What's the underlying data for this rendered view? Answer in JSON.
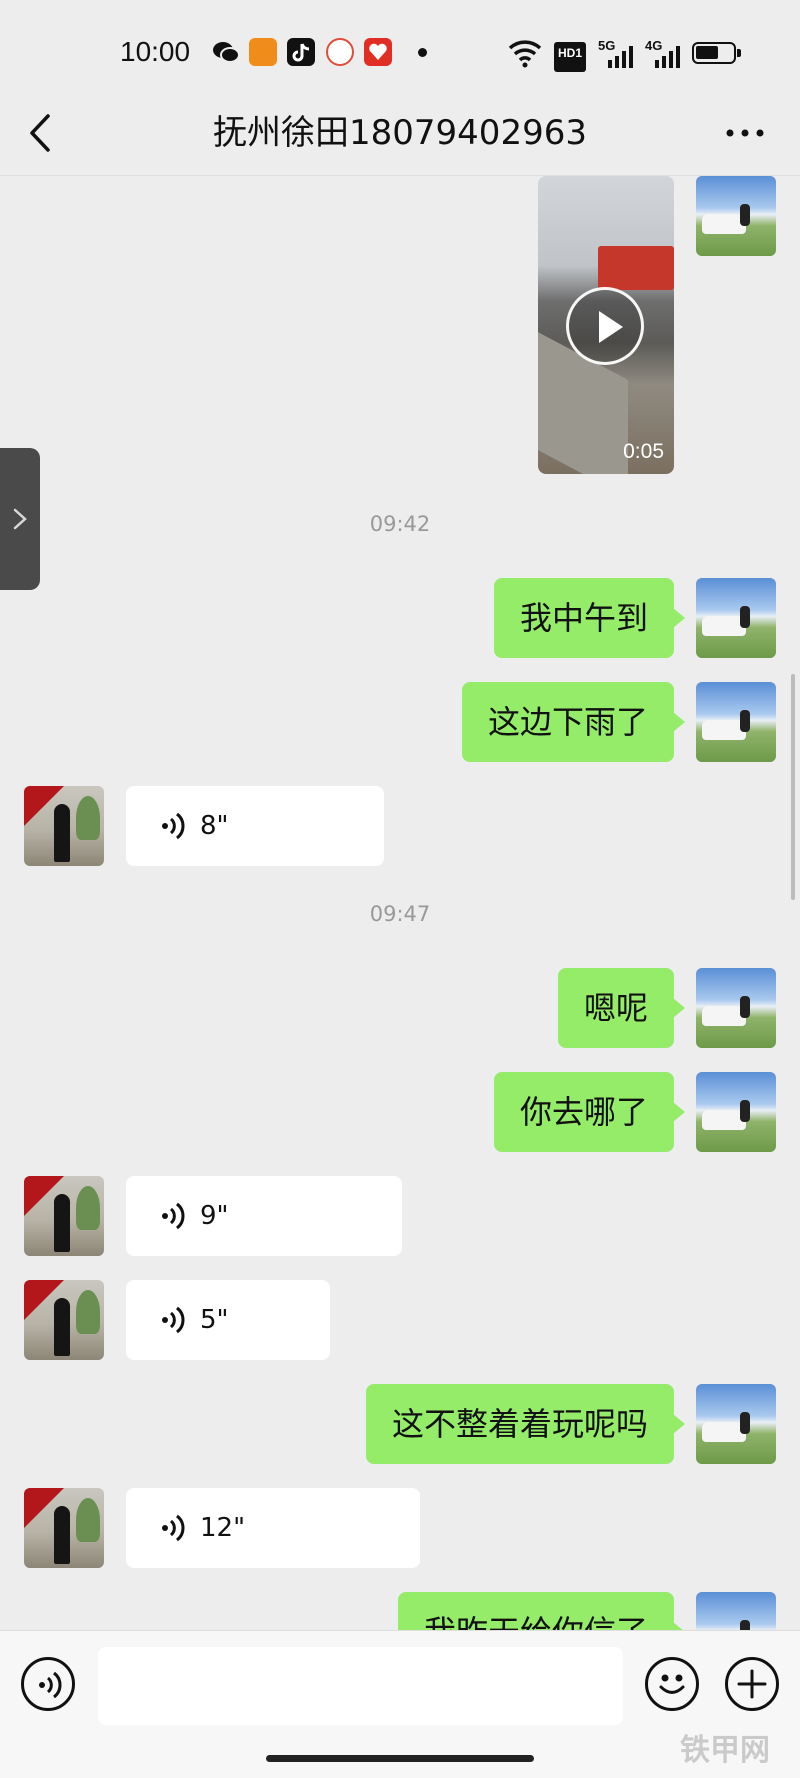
{
  "status_bar": {
    "time": "10:00",
    "apps": [
      {
        "icon": "wechat-icon",
        "color": "#111111"
      },
      {
        "icon": "bus-app-icon",
        "color": "#f08c1a"
      },
      {
        "icon": "tiktok-icon",
        "color": "#111111"
      },
      {
        "icon": "news-app-icon",
        "color": "#e34b3b"
      },
      {
        "icon": "pinduoduo-icon",
        "color": "#e02e24"
      }
    ],
    "hd_label": "HD1",
    "net1": "5G",
    "net2": "4G",
    "battery_level": 0.6
  },
  "header": {
    "title": "抚州徐田18079402963"
  },
  "messages": {
    "video": {
      "duration": "0:05"
    },
    "time_1": "09:42",
    "m1": "我中午到",
    "m2": "这边下雨了",
    "v1": "8\"",
    "time_2": "09:47",
    "m3": "嗯呢",
    "m4": "你去哪了",
    "v2": "9\"",
    "v3": "5\"",
    "m5": "这不整着着玩呢吗",
    "v4": "12\"",
    "m6": "我昨天给你信了"
  },
  "input": {
    "placeholder": ""
  },
  "watermark": "铁甲网",
  "colors": {
    "self_bubble": "#95ec69",
    "other_bubble": "#ffffff",
    "background": "#ededed"
  }
}
